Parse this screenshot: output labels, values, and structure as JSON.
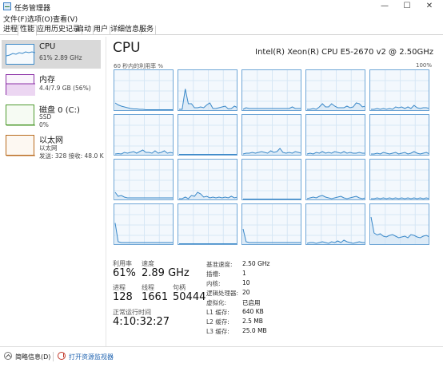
{
  "window": {
    "title": "任务管理器",
    "min": "—",
    "max": "☐",
    "close": "✕"
  },
  "menu": [
    "文件(F)",
    "选项(O)",
    "查看(V)"
  ],
  "tabs": [
    "进程",
    "性能",
    "应用历史记录",
    "启动",
    "用户",
    "详细信息",
    "服务"
  ],
  "active_tab": "性能",
  "sidebar": [
    {
      "title": "CPU",
      "lines": [
        "61% 2.89 GHz"
      ],
      "color": "#3b89c9"
    },
    {
      "title": "内存",
      "lines": [
        "4.4/7.9 GB (56%)"
      ],
      "color": "#8b2fa6"
    },
    {
      "title": "磁盘 0 (C:)",
      "lines": [
        "SSD",
        "0%"
      ],
      "color": "#4e9a2f"
    },
    {
      "title": "以太网",
      "lines": [
        "以太网",
        "发送: 328  接收: 48.0 K"
      ],
      "color": "#b86a1e"
    }
  ],
  "main": {
    "heading": "CPU",
    "model": "Intel(R) Xeon(R) CPU E5-2670 v2 @ 2.50GHz",
    "util_label": "60 秒内的利用率 %",
    "util_max": "100%"
  },
  "stats": {
    "utilization_label": "利用率",
    "utilization": "61%",
    "speed_label": "速度",
    "speed": "2.89 GHz",
    "processes_label": "进程",
    "processes": "128",
    "threads_label": "线程",
    "threads": "1661",
    "handles_label": "句柄",
    "handles": "50444",
    "uptime_label": "正常运行时间",
    "uptime": "4:10:32:27"
  },
  "details": [
    {
      "label": "基准速度:",
      "value": "2.50 GHz"
    },
    {
      "label": "插槽:",
      "value": "1"
    },
    {
      "label": "内核:",
      "value": "10"
    },
    {
      "label": "逻辑处理器:",
      "value": "20"
    },
    {
      "label": "虚拟化:",
      "value": "已启用"
    },
    {
      "label": "L1 缓存:",
      "value": "640 KB"
    },
    {
      "label": "L2 缓存:",
      "value": "2.5 MB"
    },
    {
      "label": "L3 缓存:",
      "value": "25.0 MB"
    }
  ],
  "footer": {
    "brief": "简略信息(D)",
    "monitor": "打开资源监视器"
  },
  "colors": {
    "cpu_line": "#3b89c9",
    "cpu_grid": "#d7e7f5"
  },
  "chart_data": {
    "type": "line",
    "title": "",
    "xlabel": "",
    "ylabel": "60 秒内的利用率 %",
    "ylim": [
      0,
      100
    ],
    "series": [
      {
        "values": [
          20,
          15,
          12,
          10,
          8,
          6,
          5,
          5,
          4,
          4,
          3,
          3,
          3,
          3,
          3,
          3,
          3,
          3,
          3,
          3
        ]
      },
      {
        "values": [
          4,
          4,
          55,
          18,
          18,
          8,
          8,
          10,
          8,
          15,
          20,
          6,
          6,
          8,
          10,
          12,
          5,
          6,
          12,
          8
        ]
      },
      {
        "values": [
          4,
          8,
          6,
          6,
          6,
          6,
          6,
          6,
          6,
          6,
          6,
          6,
          6,
          6,
          6,
          6,
          10,
          6,
          6,
          6
        ]
      },
      {
        "values": [
          4,
          4,
          6,
          4,
          10,
          18,
          10,
          10,
          18,
          12,
          8,
          8,
          8,
          12,
          8,
          10,
          20,
          18,
          10,
          12
        ]
      },
      {
        "values": [
          4,
          4,
          6,
          4,
          6,
          4,
          6,
          4,
          10,
          8,
          10,
          6,
          10,
          6,
          14,
          8,
          6,
          8,
          8,
          6
        ]
      },
      {
        "values": [
          4,
          5,
          4,
          8,
          6,
          8,
          10,
          6,
          10,
          14,
          8,
          8,
          6,
          12,
          6,
          8,
          12,
          6,
          8,
          6
        ]
      },
      {
        "values": [
          3,
          3,
          3,
          3,
          3,
          3,
          3,
          3,
          3,
          3,
          3,
          3,
          3,
          3,
          3,
          3,
          3,
          3,
          3,
          3
        ]
      },
      {
        "values": [
          4,
          6,
          6,
          8,
          6,
          8,
          10,
          8,
          6,
          12,
          8,
          10,
          18,
          8,
          6,
          8,
          6,
          10,
          8,
          6
        ]
      },
      {
        "values": [
          4,
          6,
          4,
          8,
          6,
          10,
          6,
          8,
          6,
          10,
          8,
          6,
          10,
          6,
          8,
          6,
          6,
          8,
          6,
          6
        ]
      },
      {
        "values": [
          4,
          4,
          6,
          4,
          8,
          6,
          4,
          6,
          8,
          4,
          6,
          8,
          4,
          6,
          10,
          6,
          4,
          6,
          8,
          4
        ]
      },
      {
        "values": [
          20,
          10,
          12,
          8,
          6,
          6,
          6,
          6,
          6,
          6,
          6,
          6,
          6,
          6,
          6,
          6,
          6,
          6,
          6,
          6
        ]
      },
      {
        "values": [
          4,
          4,
          8,
          4,
          12,
          10,
          20,
          16,
          8,
          10,
          6,
          8,
          6,
          8,
          6,
          8,
          6,
          10,
          6,
          8
        ]
      },
      {
        "values": [
          3,
          3,
          3,
          3,
          3,
          3,
          3,
          3,
          3,
          3,
          3,
          3,
          3,
          3,
          3,
          3,
          3,
          3,
          3,
          3
        ]
      },
      {
        "values": [
          4,
          6,
          8,
          6,
          10,
          12,
          8,
          6,
          4,
          6,
          8,
          10,
          6,
          4,
          6,
          8,
          10,
          6,
          4,
          6
        ]
      },
      {
        "values": [
          4,
          4,
          6,
          4,
          6,
          4,
          6,
          4,
          6,
          4,
          6,
          4,
          6,
          4,
          6,
          4,
          6,
          4,
          6,
          4
        ]
      },
      {
        "values": [
          55,
          8,
          6,
          6,
          6,
          6,
          6,
          6,
          6,
          6,
          6,
          6,
          6,
          6,
          6,
          6,
          6,
          6,
          6,
          6
        ]
      },
      {
        "values": [
          3,
          3,
          3,
          3,
          3,
          3,
          3,
          3,
          3,
          3,
          3,
          3,
          3,
          3,
          3,
          3,
          3,
          3,
          3,
          3
        ]
      },
      {
        "values": [
          40,
          8,
          6,
          6,
          6,
          6,
          6,
          6,
          6,
          6,
          6,
          6,
          6,
          6,
          6,
          6,
          6,
          6,
          6,
          6
        ]
      },
      {
        "values": [
          4,
          6,
          6,
          4,
          6,
          8,
          6,
          4,
          8,
          6,
          10,
          6,
          12,
          8,
          6,
          4,
          6,
          8,
          6,
          6
        ]
      },
      {
        "values": [
          70,
          30,
          25,
          28,
          22,
          20,
          24,
          26,
          22,
          18,
          20,
          22,
          18,
          26,
          24,
          20,
          18,
          22,
          24,
          20
        ]
      }
    ]
  }
}
